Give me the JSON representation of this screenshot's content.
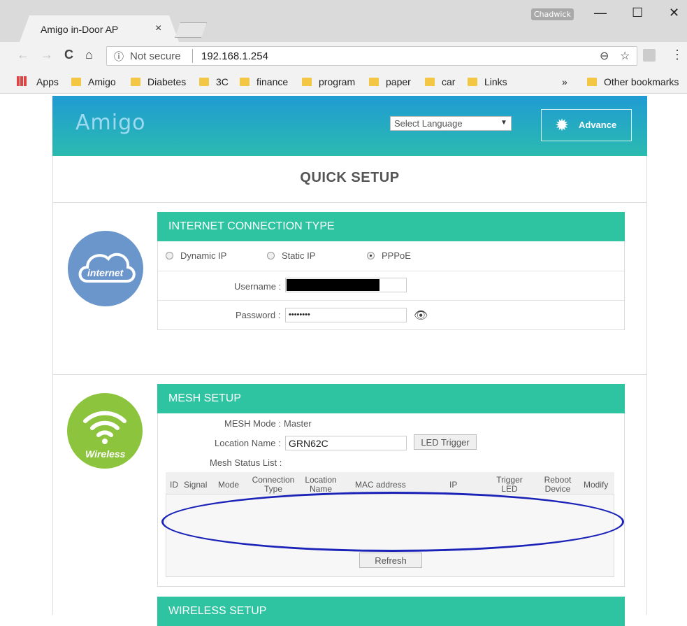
{
  "browser": {
    "tab_title": "Amigo in-Door AP",
    "tab_close": "×",
    "user_badge": "Chadwick",
    "controls": {
      "minimize": "—",
      "maximize": "☐",
      "close": "✕"
    },
    "nav": {
      "back": "←",
      "forward": "→",
      "reload": "C",
      "home": "⌂"
    },
    "security_icon": "ⓘ",
    "security_label": "Not secure",
    "url": "192.168.1.254",
    "zoom_icon": "⊖",
    "star_icon": "☆",
    "menu_icon": "⋮",
    "bookmarks": {
      "apps": "Apps",
      "items": [
        "Amigo",
        "Diabetes",
        "3C",
        "finance",
        "program",
        "paper",
        "car",
        "Links"
      ],
      "more": "»",
      "other": "Other bookmarks"
    }
  },
  "header": {
    "logo": "Amigo",
    "language_select": "Select Language",
    "language_arrow": "▼",
    "advance_label": "Advance",
    "gear_icon": "✹"
  },
  "quick_setup": {
    "title": "QUICK SETUP"
  },
  "internet": {
    "badge": "internet",
    "title": "INTERNET CONNECTION TYPE",
    "options": [
      "Dynamic IP",
      "Static IP",
      "PPPoE"
    ],
    "selected": "PPPoE",
    "username_label": "Username :",
    "password_label": "Password :",
    "password_value": "••••••••",
    "eye_icon": "👁"
  },
  "mesh": {
    "badge": "Wireless",
    "title": "MESH SETUP",
    "mode_label": "MESH Mode :",
    "mode_value": "Master",
    "location_label": "Location Name :",
    "location_value": "GRN62C",
    "led_trigger": "LED Trigger",
    "status_list_label": "Mesh Status List :",
    "columns": [
      "ID",
      "Signal",
      "Mode",
      "Connection Type",
      "Location Name",
      "MAC address",
      "IP",
      "Trigger LED",
      "Reboot Device",
      "Modify"
    ],
    "refresh": "Refresh",
    "annotation_color": "#1a22b8"
  },
  "wireless": {
    "title": "WIRELESS SETUP"
  },
  "colors": {
    "header_gradient_start": "#1f9bd3",
    "header_gradient_end": "#2bbbb0",
    "panel_head": "#2ec4a2",
    "internet_circle": "#6b96cc",
    "wireless_circle": "#8cc43d"
  }
}
